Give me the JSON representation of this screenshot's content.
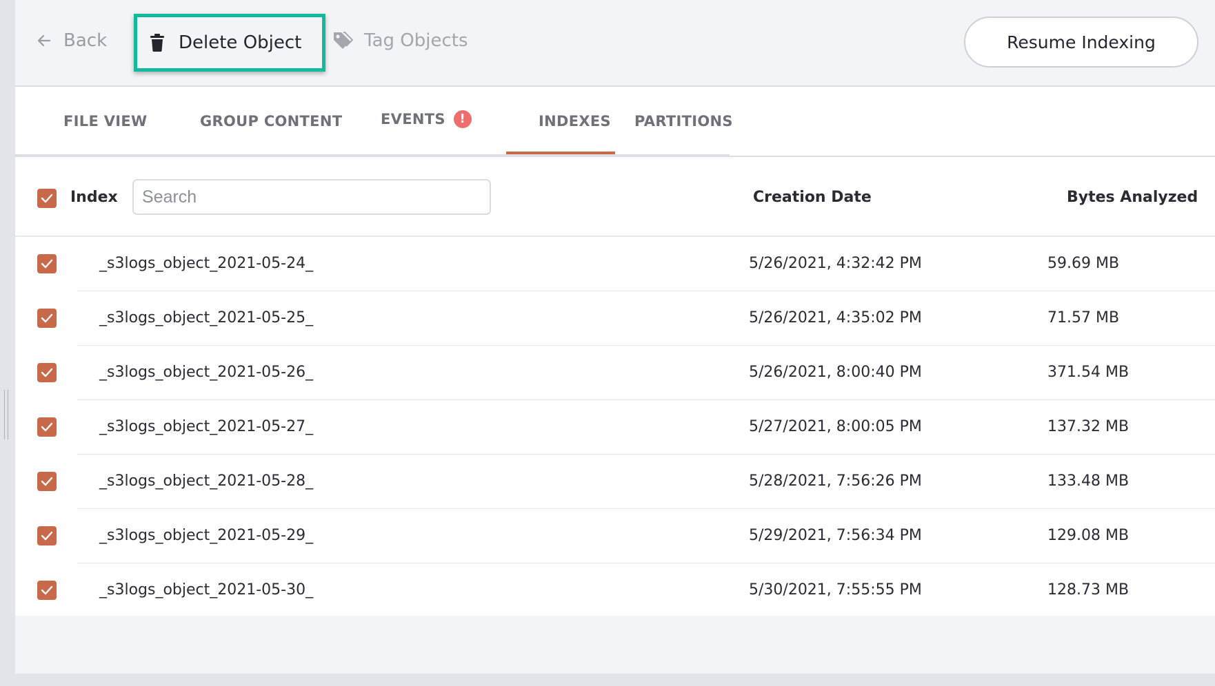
{
  "toolbar": {
    "back_label": "Back",
    "delete_label": "Delete Object",
    "tag_label": "Tag Objects",
    "resume_label": "Resume Indexing"
  },
  "tabs": [
    {
      "label": "FILE VIEW",
      "active": false
    },
    {
      "label": "GROUP CONTENT",
      "active": false
    },
    {
      "label": "EVENTS",
      "active": false,
      "alert": "!"
    },
    {
      "label": "INDEXES",
      "active": true
    },
    {
      "label": "PARTITIONS",
      "active": false
    }
  ],
  "table": {
    "header": {
      "index": "Index",
      "search_placeholder": "Search",
      "creation_date": "Creation Date",
      "bytes_analyzed": "Bytes Analyzed"
    },
    "rows": [
      {
        "name": "_s3logs_object_2021-05-24_",
        "date": "5/26/2021, 4:32:42 PM",
        "bytes": "59.69 MB"
      },
      {
        "name": "_s3logs_object_2021-05-25_",
        "date": "5/26/2021, 4:35:02 PM",
        "bytes": "71.57 MB"
      },
      {
        "name": "_s3logs_object_2021-05-26_",
        "date": "5/26/2021, 8:00:40 PM",
        "bytes": "371.54 MB"
      },
      {
        "name": "_s3logs_object_2021-05-27_",
        "date": "5/27/2021, 8:00:05 PM",
        "bytes": "137.32 MB"
      },
      {
        "name": "_s3logs_object_2021-05-28_",
        "date": "5/28/2021, 7:56:26 PM",
        "bytes": "133.48 MB"
      },
      {
        "name": "_s3logs_object_2021-05-29_",
        "date": "5/29/2021, 7:56:34 PM",
        "bytes": "129.08 MB"
      },
      {
        "name": "_s3logs_object_2021-05-30_",
        "date": "5/30/2021, 7:55:55 PM",
        "bytes": "128.73 MB"
      }
    ]
  },
  "colors": {
    "accent": "#c8694a",
    "highlight": "#14b89a",
    "alert": "#ee6d6d"
  }
}
